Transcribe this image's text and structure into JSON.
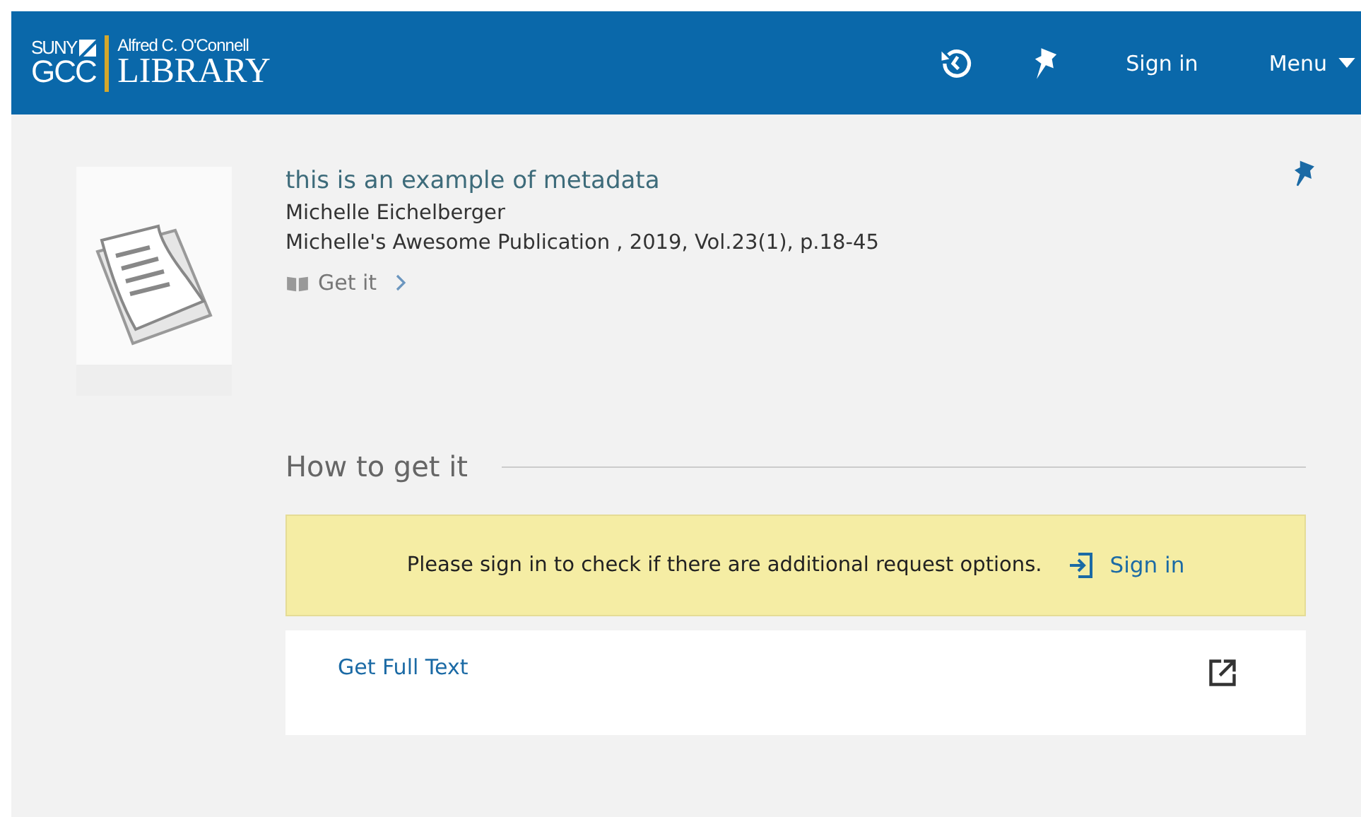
{
  "header": {
    "logo": {
      "top_left": "SUNY",
      "bottom_left": "GCC",
      "top_right": "Alfred C. O'Connell",
      "bottom_right": "LIBRARY"
    },
    "sign_in": "Sign in",
    "menu": "Menu"
  },
  "record": {
    "title": "this is an example of metadata",
    "author": "Michelle Eichelberger",
    "source": "Michelle's Awesome Publication , 2019, Vol.23(1), p.18-45",
    "get_it": "Get it",
    "pinned": true
  },
  "how_to_get_it": {
    "heading": "How to get it",
    "notice": "Please sign in to check if there are additional request options.",
    "sign_in": "Sign in",
    "link": "Get Full Text"
  }
}
